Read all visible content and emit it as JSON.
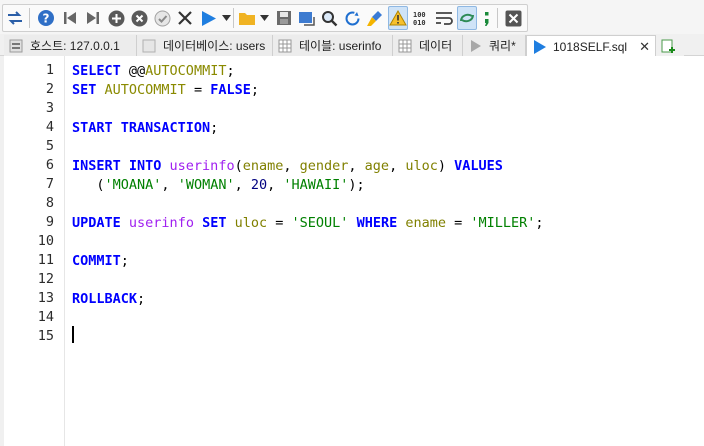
{
  "toolbar": {
    "buttons": [
      {
        "icon": "transfer-icon"
      },
      {
        "icon": "help-icon"
      },
      {
        "icon": "first-record-icon"
      },
      {
        "icon": "last-record-icon"
      },
      {
        "icon": "add-row-icon"
      },
      {
        "icon": "delete-row-icon"
      },
      {
        "icon": "apply-icon"
      },
      {
        "icon": "cancel-icon"
      },
      {
        "icon": "run-query-icon"
      },
      {
        "icon": "run-dropdown-icon"
      },
      {
        "icon": "open-folder-icon"
      },
      {
        "icon": "open-dropdown-icon"
      },
      {
        "icon": "save-icon"
      },
      {
        "icon": "export-icon"
      },
      {
        "icon": "find-icon"
      },
      {
        "icon": "replace-icon"
      },
      {
        "icon": "clean-icon"
      },
      {
        "icon": "warning-icon"
      },
      {
        "icon": "binary-icon"
      },
      {
        "icon": "word-wrap-icon"
      },
      {
        "icon": "sync-icon"
      },
      {
        "icon": "semicolon-icon"
      },
      {
        "icon": "close-icon"
      }
    ]
  },
  "tabs": [
    {
      "label": "호스트: 127.0.0.1",
      "icon": "host-icon",
      "active": false
    },
    {
      "label": "데이터베이스: users",
      "icon": "database-icon",
      "active": false
    },
    {
      "label": "테이블: userinfo",
      "icon": "table-icon",
      "active": false
    },
    {
      "label": "데이터",
      "icon": "grid-icon",
      "active": false
    },
    {
      "label": "쿼리*",
      "icon": "query-icon",
      "active": false
    },
    {
      "label": "1018SELF.sql",
      "icon": "play-icon",
      "active": true,
      "close": "✕"
    }
  ],
  "editor": {
    "line_numbers": [
      "1",
      "2",
      "3",
      "4",
      "5",
      "6",
      "7",
      "8",
      "9",
      "10",
      "11",
      "12",
      "13",
      "14",
      "15"
    ],
    "lines": [
      [
        {
          "t": "SELECT",
          "c": "kw"
        },
        {
          "t": " @@",
          "c": "op"
        },
        {
          "t": "AUTOCOMMIT",
          "c": "fn"
        },
        {
          "t": ";",
          "c": "punct"
        }
      ],
      [
        {
          "t": "SET",
          "c": "kw"
        },
        {
          "t": " ",
          "c": "op"
        },
        {
          "t": "AUTOCOMMIT",
          "c": "fn"
        },
        {
          "t": " = ",
          "c": "op"
        },
        {
          "t": "FALSE",
          "c": "kw"
        },
        {
          "t": ";",
          "c": "punct"
        }
      ],
      [],
      [
        {
          "t": "START TRANSACTION",
          "c": "kw"
        },
        {
          "t": ";",
          "c": "punct"
        }
      ],
      [],
      [
        {
          "t": "INSERT INTO",
          "c": "kw"
        },
        {
          "t": " ",
          "c": "op"
        },
        {
          "t": "userinfo",
          "c": "tbl"
        },
        {
          "t": "(",
          "c": "punct"
        },
        {
          "t": "ename",
          "c": "col"
        },
        {
          "t": ", ",
          "c": "punct"
        },
        {
          "t": "gender",
          "c": "col"
        },
        {
          "t": ", ",
          "c": "punct"
        },
        {
          "t": "age",
          "c": "col"
        },
        {
          "t": ", ",
          "c": "punct"
        },
        {
          "t": "uloc",
          "c": "col"
        },
        {
          "t": ") ",
          "c": "punct"
        },
        {
          "t": "VALUES",
          "c": "kw"
        }
      ],
      [
        {
          "t": "   (",
          "c": "punct"
        },
        {
          "t": "'MOANA'",
          "c": "str"
        },
        {
          "t": ", ",
          "c": "punct"
        },
        {
          "t": "'WOMAN'",
          "c": "str"
        },
        {
          "t": ", ",
          "c": "punct"
        },
        {
          "t": "20",
          "c": "num"
        },
        {
          "t": ", ",
          "c": "punct"
        },
        {
          "t": "'HAWAII'",
          "c": "str"
        },
        {
          "t": ");",
          "c": "punct"
        }
      ],
      [],
      [
        {
          "t": "UPDATE",
          "c": "kw"
        },
        {
          "t": " ",
          "c": "op"
        },
        {
          "t": "userinfo",
          "c": "tbl"
        },
        {
          "t": " ",
          "c": "op"
        },
        {
          "t": "SET",
          "c": "kw"
        },
        {
          "t": " ",
          "c": "op"
        },
        {
          "t": "uloc",
          "c": "col"
        },
        {
          "t": " = ",
          "c": "op"
        },
        {
          "t": "'SEOUL'",
          "c": "str"
        },
        {
          "t": " ",
          "c": "op"
        },
        {
          "t": "WHERE",
          "c": "kw"
        },
        {
          "t": " ",
          "c": "op"
        },
        {
          "t": "ename",
          "c": "col"
        },
        {
          "t": " = ",
          "c": "op"
        },
        {
          "t": "'MILLER'",
          "c": "str"
        },
        {
          "t": ";",
          "c": "punct"
        }
      ],
      [],
      [
        {
          "t": "COMMIT",
          "c": "kw"
        },
        {
          "t": ";",
          "c": "punct"
        }
      ],
      [],
      [
        {
          "t": "ROLLBACK",
          "c": "kw"
        },
        {
          "t": ";",
          "c": "punct"
        }
      ],
      [],
      []
    ]
  }
}
